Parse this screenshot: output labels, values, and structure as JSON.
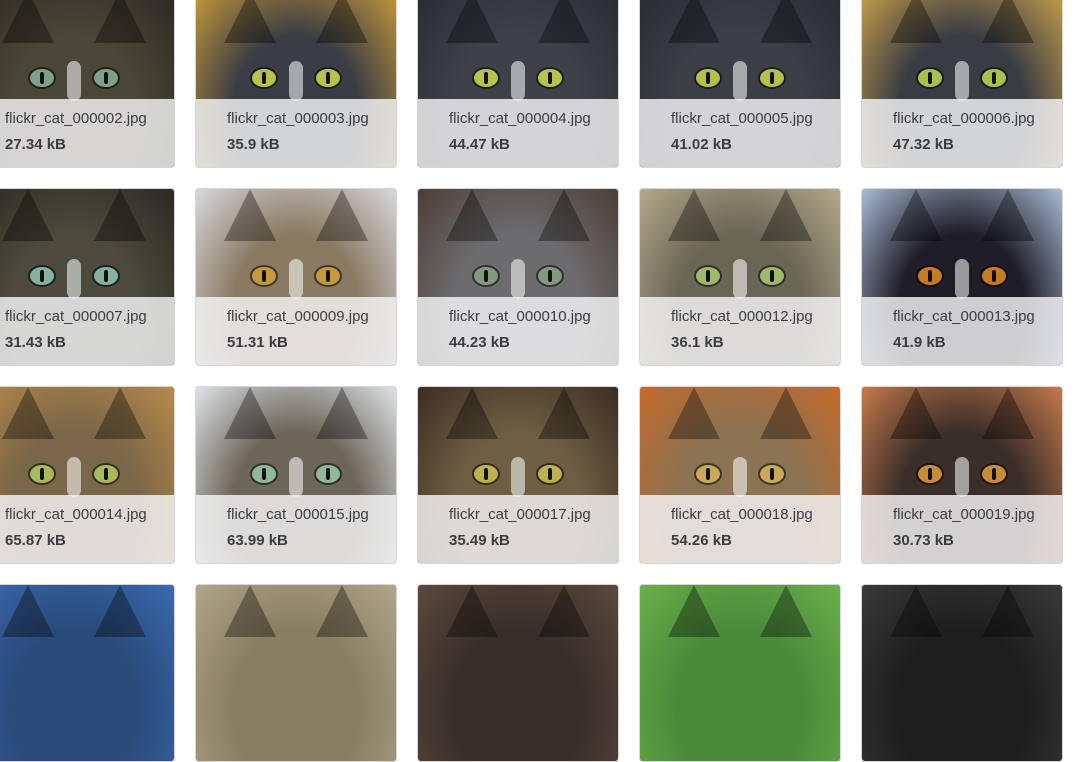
{
  "gallery": {
    "rows": [
      [
        {
          "filename": "flickr_cat_000002.jpg",
          "size": "27.34 kB",
          "fur": "#4a4638",
          "fur2": "#2b2a22",
          "eye": "#7fa08a"
        },
        {
          "filename": "flickr_cat_000003.jpg",
          "size": "35.9 kB",
          "fur": "#3b3d44",
          "fur2": "#c79a3a",
          "eye": "#b9c24a"
        },
        {
          "filename": "flickr_cat_000004.jpg",
          "size": "44.47 kB",
          "fur": "#3f4149",
          "fur2": "#2a2c33",
          "eye": "#b9c24a"
        },
        {
          "filename": "flickr_cat_000005.jpg",
          "size": "41.02 kB",
          "fur": "#3d3f47",
          "fur2": "#2a2c32",
          "eye": "#b4c04a"
        },
        {
          "filename": "flickr_cat_000006.jpg",
          "size": "47.32 kB",
          "fur": "#3a3c44",
          "fur2": "#c8a04a",
          "eye": "#a9c24e"
        }
      ],
      [
        {
          "filename": "flickr_cat_000007.jpg",
          "size": "31.43 kB",
          "fur": "#4b4a3c",
          "fur2": "#2a2a22",
          "eye": "#86b0a0"
        },
        {
          "filename": "flickr_cat_000009.jpg",
          "size": "51.31 kB",
          "fur": "#8a7a62",
          "fur2": "#d9d9de",
          "eye": "#c79a3a"
        },
        {
          "filename": "flickr_cat_000010.jpg",
          "size": "44.23 kB",
          "fur": "#6c6b6e",
          "fur2": "#4c3e35",
          "eye": "#7f9a7c"
        },
        {
          "filename": "flickr_cat_000012.jpg",
          "size": "36.1 kB",
          "fur": "#6a6656",
          "fur2": "#b5a98a",
          "eye": "#9fb86e"
        },
        {
          "filename": "flickr_cat_000013.jpg",
          "size": "41.9 kB",
          "fur": "#1f1d26",
          "fur2": "#a9bcd6",
          "eye": "#c77a22"
        }
      ],
      [
        {
          "filename": "flickr_cat_000014.jpg",
          "size": "65.87 kB",
          "fur": "#7a6648",
          "fur2": "#b78a4a",
          "eye": "#a8b85a"
        },
        {
          "filename": "flickr_cat_000015.jpg",
          "size": "63.99 kB",
          "fur": "#6c6658",
          "fur2": "#dfe3ea",
          "eye": "#8fb89a"
        },
        {
          "filename": "flickr_cat_000017.jpg",
          "size": "35.49 kB",
          "fur": "#6e5e44",
          "fur2": "#3a2c22",
          "eye": "#c2b04a"
        },
        {
          "filename": "flickr_cat_000018.jpg",
          "size": "54.26 kB",
          "fur": "#8a7252",
          "fur2": "#c76a2a",
          "eye": "#c9a85a"
        },
        {
          "filename": "flickr_cat_000019.jpg",
          "size": "30.73 kB",
          "fur": "#3a2e2a",
          "fur2": "#c77a4a",
          "eye": "#c98a3a"
        }
      ],
      [
        {
          "filename": "",
          "size": "",
          "fur": "#2a4a7a",
          "fur2": "#3a6ab0",
          "eye": "#000000"
        },
        {
          "filename": "",
          "size": "",
          "fur": "#8a7e62",
          "fur2": "#b0a688",
          "eye": "#000000"
        },
        {
          "filename": "",
          "size": "",
          "fur": "#3a2e2a",
          "fur2": "#5a4a3c",
          "eye": "#000000"
        },
        {
          "filename": "",
          "size": "",
          "fur": "#4a8a3a",
          "fur2": "#6ab04a",
          "eye": "#000000"
        },
        {
          "filename": "",
          "size": "",
          "fur": "#1e1e1e",
          "fur2": "#3a3a3a",
          "eye": "#000000"
        }
      ]
    ]
  }
}
